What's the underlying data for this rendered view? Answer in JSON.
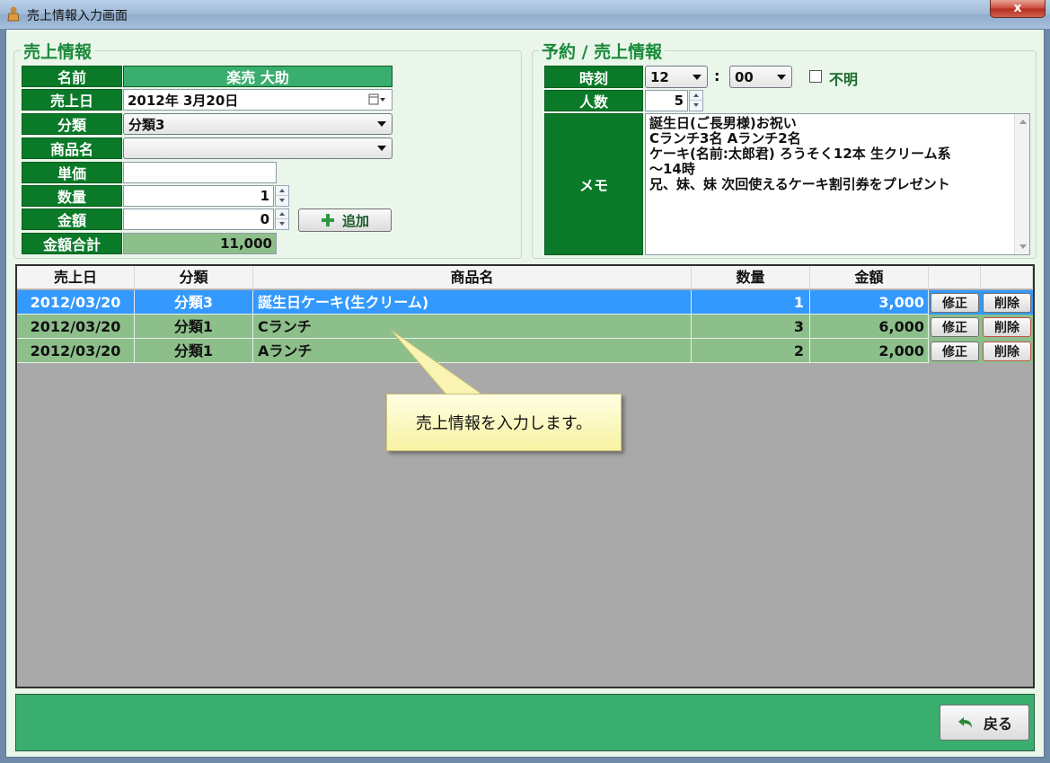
{
  "window": {
    "title": "売上情報入力画面",
    "close_label": "x"
  },
  "sales_group": {
    "title": "売上情報",
    "name_label": "名前",
    "name_value": "楽売 大助",
    "date_label": "売上日",
    "date_value": "2012年  3月20日",
    "category_label": "分類",
    "category_value": "分類3",
    "product_label": "商品名",
    "product_value": "",
    "price_label": "単価",
    "price_value": "",
    "qty_label": "数量",
    "qty_value": "1",
    "amount_label": "金額",
    "amount_value": "0",
    "add_label": "追加",
    "total_label": "金額合計",
    "total_value": "11,000"
  },
  "reservation_group": {
    "title": "予約 / 売上情報",
    "time_label": "時刻",
    "hour_value": "12",
    "colon": ":",
    "minute_value": "00",
    "unknown_label": "不明",
    "people_label": "人数",
    "people_value": "5",
    "memo_label": "メモ",
    "memo_lines": [
      "誕生日(ご長男様)お祝い",
      "Cランチ3名  Aランチ2名",
      "ケーキ(名前:太郎君)  ろうそく12本  生クリーム系",
      "～14時",
      "兄、妹、妹  次回使えるケーキ割引券をプレゼント"
    ]
  },
  "grid": {
    "headers": [
      "売上日",
      "分類",
      "商品名",
      "数量",
      "金額"
    ],
    "rows": [
      {
        "date": "2012/03/20",
        "category": "分類3",
        "product": "誕生日ケーキ(生クリーム)",
        "qty": "1",
        "amount": "3,000",
        "edit": "修正",
        "delete": "削除"
      },
      {
        "date": "2012/03/20",
        "category": "分類1",
        "product": "Cランチ",
        "qty": "3",
        "amount": "6,000",
        "edit": "修正",
        "delete": "削除"
      },
      {
        "date": "2012/03/20",
        "category": "分類1",
        "product": "Aランチ",
        "qty": "2",
        "amount": "2,000",
        "edit": "修正",
        "delete": "削除"
      }
    ]
  },
  "callout": {
    "text": "売上情報を入力します。"
  },
  "footer": {
    "back_label": "戻る"
  },
  "colors": {
    "label_green": "#0a7a28",
    "selected_row": "#3399ff",
    "row_green": "#8dbf8b",
    "footer_green": "#3aae6e"
  }
}
